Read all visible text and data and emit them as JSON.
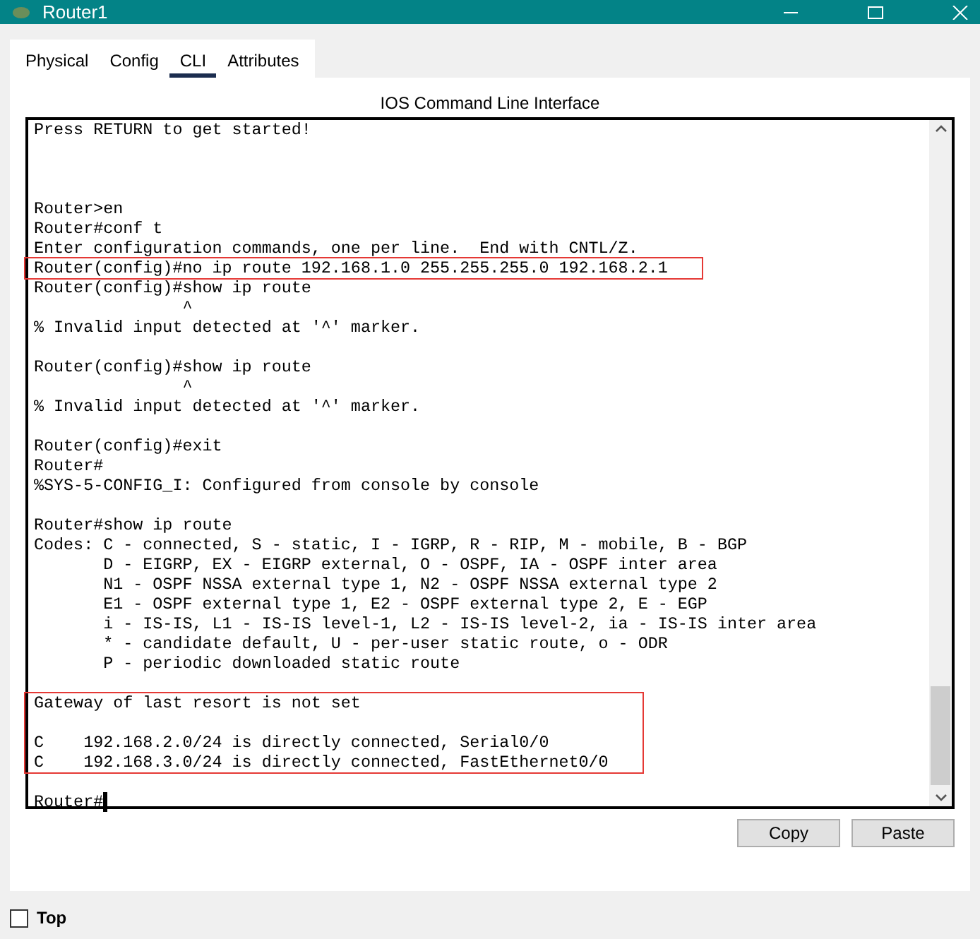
{
  "window": {
    "title": "Router1"
  },
  "tabs": [
    {
      "label": "Physical",
      "selected": false
    },
    {
      "label": "Config",
      "selected": false
    },
    {
      "label": "CLI",
      "selected": true
    },
    {
      "label": "Attributes",
      "selected": false
    }
  ],
  "panel_title": "IOS Command Line Interface",
  "terminal": {
    "banner": "Press RETURN to get started!",
    "blocks": [
      {
        "boxed": false,
        "paragraphs": [
          [
            "Router>en",
            "Router#conf t",
            "Enter configuration commands, one per line.  End with CNTL/Z."
          ]
        ]
      },
      {
        "boxed": true,
        "paragraphs": [
          [
            "Router(config)#no ip route 192.168.1.0 255.255.255.0 192.168.2.1"
          ]
        ]
      },
      {
        "boxed": false,
        "paragraphs": [
          [
            "Router(config)#show ip route",
            "               ^",
            "% Invalid input detected at '^' marker."
          ],
          [
            "Router(config)#show ip route",
            "               ^",
            "% Invalid input detected at '^' marker."
          ],
          [
            "Router(config)#exit",
            "Router#",
            "%SYS-5-CONFIG_I: Configured from console by console"
          ],
          [
            "Router#show ip route",
            "Codes: C - connected, S - static, I - IGRP, R - RIP, M - mobile, B - BGP",
            "       D - EIGRP, EX - EIGRP external, O - OSPF, IA - OSPF inter area",
            "       N1 - OSPF NSSA external type 1, N2 - OSPF NSSA external type 2",
            "       E1 - OSPF external type 1, E2 - OSPF external type 2, E - EGP",
            "       i - IS-IS, L1 - IS-IS level-1, L2 - IS-IS level-2, ia - IS-IS inter area",
            "       * - candidate default, U - per-user static route, o - ODR",
            "       P - periodic downloaded static route"
          ]
        ]
      },
      {
        "boxed": true,
        "paragraphs": [
          [
            "Gateway of last resort is not set"
          ],
          [
            "C    192.168.2.0/24 is directly connected, Serial0/0",
            "C    192.168.3.0/24 is directly connected, FastEthernet0/0"
          ]
        ]
      }
    ],
    "prompt": "Router#"
  },
  "buttons": [
    "Copy",
    "Paste"
  ],
  "top_checkbox": {
    "label": "Top",
    "checked": false
  }
}
